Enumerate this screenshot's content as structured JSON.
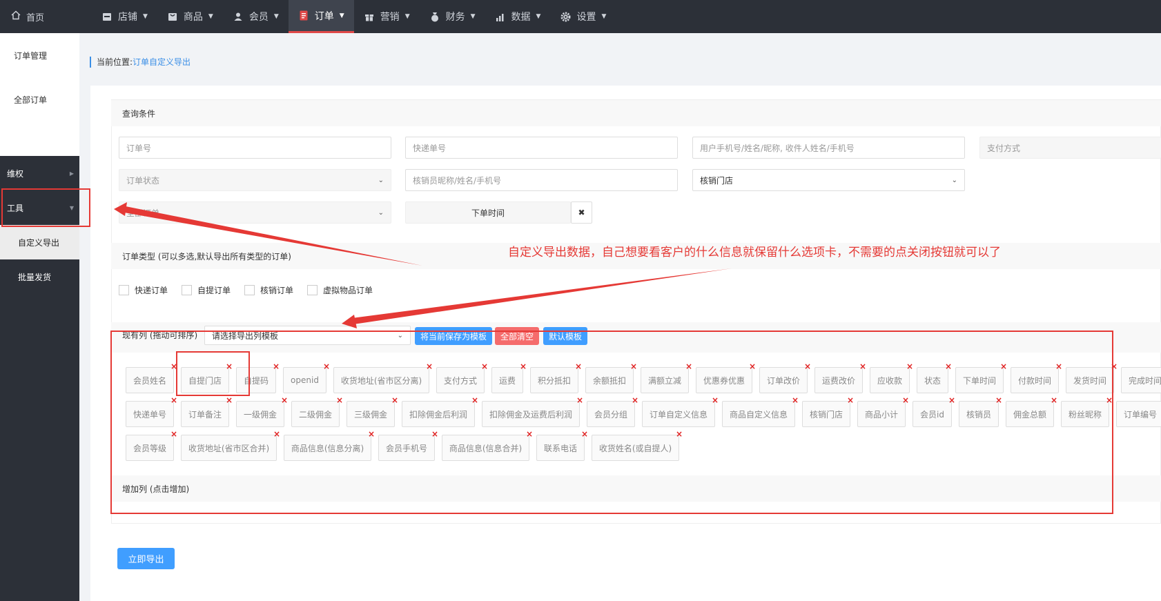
{
  "topnav": {
    "home": "首页",
    "items": [
      {
        "label": "店铺",
        "icon": "store-icon"
      },
      {
        "label": "商品",
        "icon": "goods-icon"
      },
      {
        "label": "会员",
        "icon": "user-icon"
      },
      {
        "label": "订单",
        "icon": "order-icon",
        "active": true
      },
      {
        "label": "营销",
        "icon": "gift-icon"
      },
      {
        "label": "财务",
        "icon": "money-bag-icon"
      },
      {
        "label": "数据",
        "icon": "bar-chart-icon"
      },
      {
        "label": "设置",
        "icon": "gear-icon"
      }
    ]
  },
  "sidebar": {
    "title": "订单管理",
    "all_orders": "全部订单",
    "rights": "维权",
    "tools": "工具",
    "custom_export": "自定义导出",
    "batch_ship": "批量发货"
  },
  "breadcrumb": {
    "prefix": "当前位置:",
    "current": "订单自定义导出"
  },
  "query": {
    "title": "查询条件",
    "order_no": "订单号",
    "express_no": "快递单号",
    "user_info": "用户手机号/姓名/昵称, 收件人姓名/手机号",
    "pay_method": "支付方式",
    "order_status": "订单状态",
    "verifier": "核销员昵称/姓名/手机号",
    "verify_store": "核销门店",
    "order_filter": "全部订单",
    "order_time": "下单时间"
  },
  "order_type": {
    "title": "订单类型 (可以多选,默认导出所有类型的订单)",
    "options": [
      "快递订单",
      "自提订单",
      "核销订单",
      "虚拟物品订单"
    ]
  },
  "columns": {
    "title": "现有列 (拖动可排序)",
    "template_placeholder": "请选择导出列模板",
    "save_template": "将当前保存为模板",
    "clear_all": "全部清空",
    "default_template": "默认模板",
    "rows": [
      [
        "会员姓名",
        "自提门店",
        "自提码",
        "openid",
        "收货地址(省市区分离)",
        "支付方式",
        "运费",
        "积分抵扣",
        "余额抵扣",
        "满额立减",
        "优惠券优惠",
        "订单改价",
        "运费改价",
        "应收款",
        "状态",
        "下单时间",
        "付款时间",
        "发货时间",
        "完成时间"
      ],
      [
        "快递单号",
        "订单备注",
        "一级佣金",
        "二级佣金",
        "三级佣金",
        "扣除佣金后利润",
        "扣除佣金及运费后利润",
        "会员分组",
        "订单自定义信息",
        "商品自定义信息",
        "核销门店",
        "商品小计",
        "会员id",
        "核销员",
        "佣金总额",
        "粉丝昵称",
        "订单编号"
      ],
      [
        "会员等级",
        "收货地址(省市区合并)",
        "商品信息(信息分离)",
        "会员手机号",
        "商品信息(信息合并)",
        "联系电话",
        "收货姓名(或自提人)"
      ]
    ],
    "remove_mark": "×"
  },
  "add_columns": {
    "title": "增加列 (点击增加)"
  },
  "annotation": "自定义导出数据，自己想要看客户的什么信息就保留什么选项卡，不需要的点关闭按钮就可以了",
  "export_button": "立即导出",
  "colors": {
    "topbar": "#2c3038",
    "accent": "#409eff",
    "danger": "#f56c6c",
    "annotation": "#e53935"
  }
}
